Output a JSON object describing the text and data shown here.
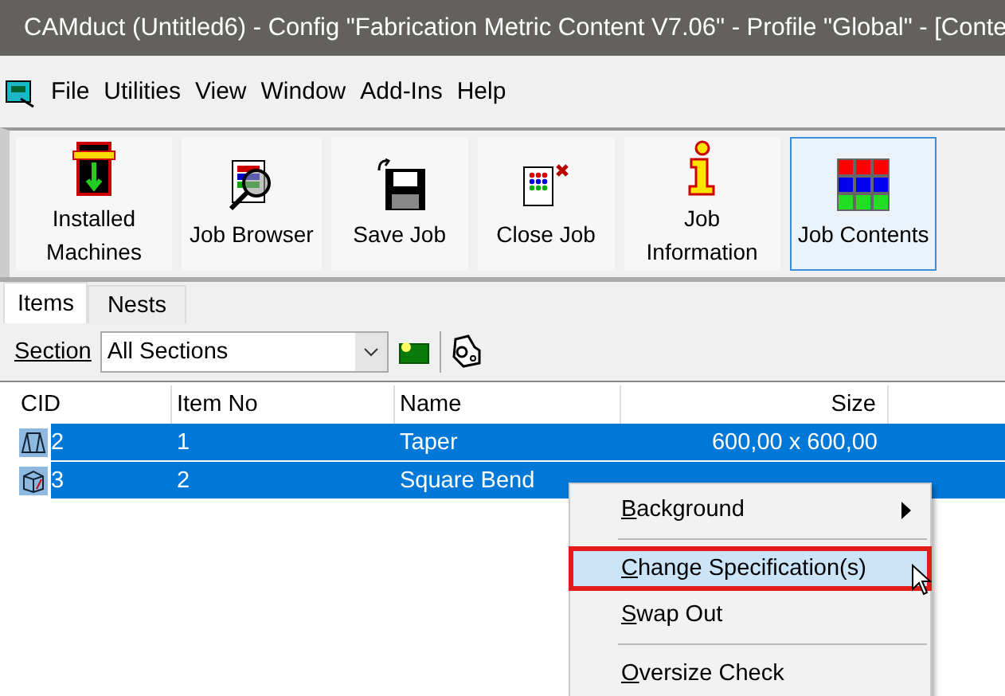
{
  "window": {
    "title": "CAMduct (Untitled6) - Config \"Fabrication Metric Content V7.06\" - Profile \"Global\" - [Conte"
  },
  "menu_bar": [
    "File",
    "Utilities",
    "View",
    "Window",
    "Add-Ins",
    "Help"
  ],
  "toolbar": [
    {
      "label": "Installed Machines",
      "kind": "machines",
      "selected": false
    },
    {
      "label": "Job Browser",
      "kind": "browser",
      "selected": false
    },
    {
      "label": "Save Job",
      "kind": "save",
      "selected": false
    },
    {
      "label": "Close Job",
      "kind": "close",
      "selected": false
    },
    {
      "label": "Job Information",
      "kind": "info",
      "selected": false
    },
    {
      "label": "Job Contents",
      "kind": "contents",
      "selected": true
    }
  ],
  "tabs": [
    {
      "label": "Items",
      "selected": true
    },
    {
      "label": "Nests",
      "selected": false
    }
  ],
  "section": {
    "label": "Section",
    "value": "All Sections"
  },
  "table": {
    "columns": [
      "CID",
      "Item No",
      "Name",
      "Size"
    ],
    "rows": [
      {
        "kind": "taper",
        "cid": "2",
        "item_no": "1",
        "name": "Taper",
        "size": "600,00 x 600,00",
        "selected": true
      },
      {
        "kind": "bend",
        "cid": "3",
        "item_no": "2",
        "name": "Square Bend",
        "selected": true
      }
    ]
  },
  "context_menu": [
    {
      "kind": "item",
      "label": "Background",
      "submenu": true,
      "selected": false,
      "outlined": false
    },
    {
      "kind": "separator"
    },
    {
      "kind": "item",
      "label": "Change Specification(s)",
      "submenu": false,
      "selected": true,
      "outlined": true
    },
    {
      "kind": "item",
      "label": "Swap Out",
      "submenu": false,
      "selected": false,
      "outlined": false
    },
    {
      "kind": "separator"
    },
    {
      "kind": "item",
      "label": "Oversize Check",
      "submenu": false,
      "selected": false,
      "outlined": false
    }
  ]
}
